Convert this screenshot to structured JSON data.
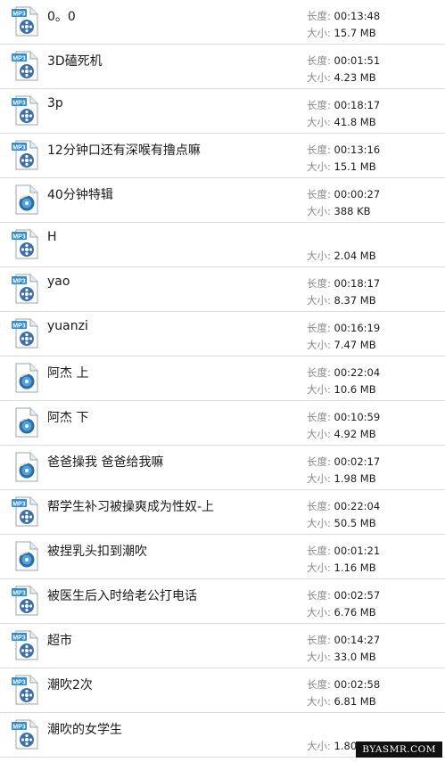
{
  "labels": {
    "duration": "长度:",
    "size": "大小:"
  },
  "files": [
    {
      "name": "0。0",
      "type": "mp3",
      "icon": "mp3-file-icon",
      "duration": "00:13:48",
      "size": "15.7 MB"
    },
    {
      "name": "3D磕死机",
      "type": "mp3",
      "icon": "mp3-file-icon",
      "duration": "00:01:51",
      "size": "4.23 MB"
    },
    {
      "name": "3p",
      "type": "mp3",
      "icon": "mp3-file-icon",
      "duration": "00:18:17",
      "size": "41.8 MB"
    },
    {
      "name": "12分钟口还有深喉有撸点嘛",
      "type": "mp3",
      "icon": "mp3-file-icon",
      "duration": "00:13:16",
      "size": "15.1 MB"
    },
    {
      "name": "40分钟特辑",
      "type": "audio",
      "icon": "audio-file-icon",
      "duration": "00:00:27",
      "size": "388 KB"
    },
    {
      "name": "H",
      "type": "mp3",
      "icon": "mp3-file-icon",
      "duration": "",
      "size": "2.04 MB"
    },
    {
      "name": "yao",
      "type": "mp3",
      "icon": "mp3-file-icon",
      "duration": "00:18:17",
      "size": "8.37 MB"
    },
    {
      "name": "yuanzi",
      "type": "mp3",
      "icon": "mp3-file-icon",
      "duration": "00:16:19",
      "size": "7.47 MB"
    },
    {
      "name": "阿杰 上",
      "type": "audio",
      "icon": "audio-file-icon",
      "duration": "00:22:04",
      "size": "10.6 MB"
    },
    {
      "name": "阿杰 下",
      "type": "audio",
      "icon": "audio-file-icon",
      "duration": "00:10:59",
      "size": "4.92 MB"
    },
    {
      "name": "爸爸操我 爸爸给我嘛",
      "type": "audio",
      "icon": "audio-file-icon",
      "duration": "00:02:17",
      "size": "1.98 MB"
    },
    {
      "name": "帮学生补习被操爽成为性奴-上",
      "type": "mp3",
      "icon": "mp3-file-icon",
      "duration": "00:22:04",
      "size": "50.5 MB"
    },
    {
      "name": "被捏乳头扣到潮吹",
      "type": "audio",
      "icon": "audio-file-icon",
      "duration": "00:01:21",
      "size": "1.16 MB"
    },
    {
      "name": "被医生后入时给老公打电话",
      "type": "mp3",
      "icon": "mp3-file-icon",
      "duration": "00:02:57",
      "size": "6.76 MB"
    },
    {
      "name": "超市",
      "type": "mp3",
      "icon": "mp3-file-icon",
      "duration": "00:14:27",
      "size": "33.0 MB"
    },
    {
      "name": "潮吹2次",
      "type": "mp3",
      "icon": "mp3-file-icon",
      "duration": "00:02:58",
      "size": "6.81 MB"
    },
    {
      "name": "潮吹的女学生",
      "type": "mp3",
      "icon": "mp3-file-icon",
      "duration": "",
      "size": "1.80 MB"
    }
  ],
  "watermark": "BYASMR.COM",
  "colors": {
    "mp3_badge": "#2d8fd0",
    "reel": "#3a6fb2",
    "divider": "#d9d9d9"
  }
}
